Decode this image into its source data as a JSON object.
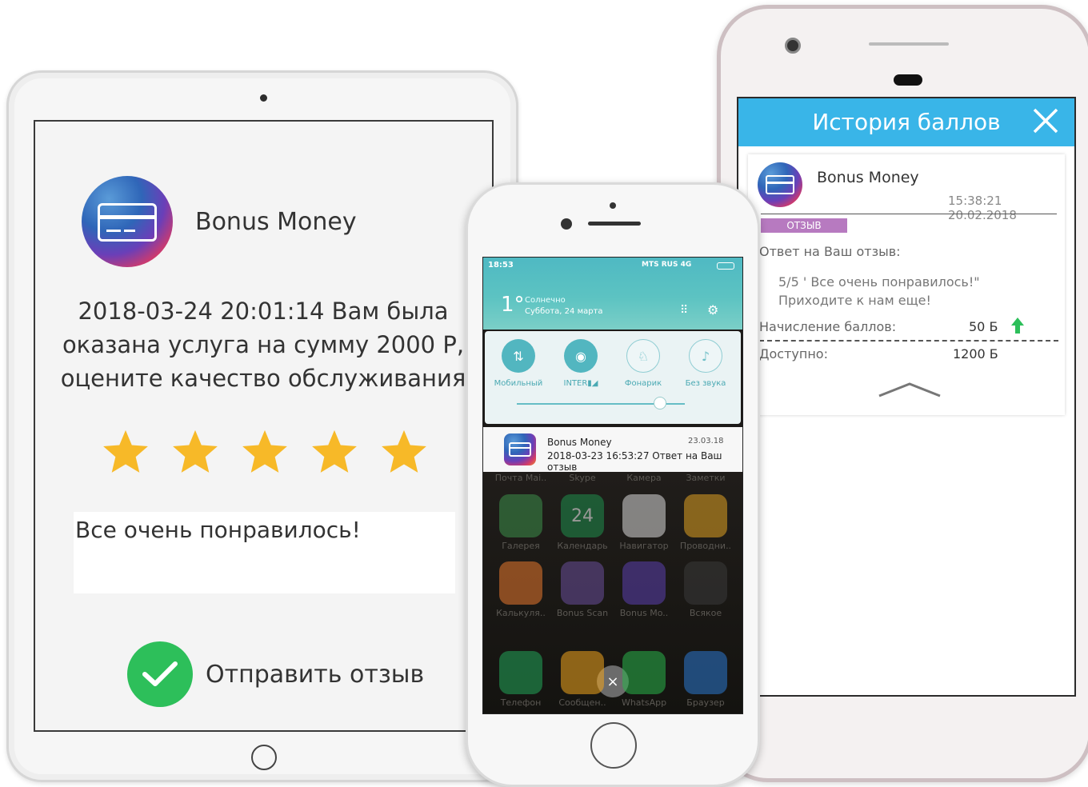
{
  "tablet": {
    "brand": "Bonus Money",
    "message": "2018-03-24 20:01:14 Вам была оказана услуга на сумму 2000 Р, оцените качество обслуживания",
    "rating": 5,
    "review_text": "Все очень понравилось!",
    "send_label": "Отправить отзыв",
    "colors": {
      "star": "#f7b928",
      "send": "#2dbf5a"
    }
  },
  "history": {
    "title": "История баллов",
    "brand": "Bonus Money",
    "timestamp": "15:38:21 20.02.2018",
    "tag": "ОТЗЫВ",
    "answer_label": "Ответ на Ваш отзыв:",
    "quote_line1": "5/5 ' Все очень понравилось!\"",
    "quote_line2": "Приходите к нам еще!",
    "accrual_label": "Начисление баллов:",
    "accrual_value": "50 Б",
    "available_label": "Доступно:",
    "available_value": "1200 Б",
    "colors": {
      "header": "#39b5e8",
      "tag": "#b77ac0",
      "arrow": "#2dbf5a"
    }
  },
  "iphone": {
    "status_time": "18:53",
    "carrier": "MTS RUS 4G",
    "temperature": "1°",
    "weather": "Солнечно",
    "date": "Суббота, 24 марта",
    "quick_settings": [
      {
        "label": "Мобильный",
        "icon": "data-arrows-icon",
        "glyph": "⇅",
        "state": "on"
      },
      {
        "label": "INTER▮◢",
        "icon": "wifi-icon",
        "glyph": "◉",
        "state": "on"
      },
      {
        "label": "Фонарик",
        "icon": "flashlight-icon",
        "glyph": "♘",
        "state": "off"
      },
      {
        "label": "Без звука",
        "icon": "bell-off-icon",
        "glyph": "♪",
        "state": "off"
      }
    ],
    "brightness": 0.85,
    "notification": {
      "title": "Bonus Money",
      "date": "23.03.18",
      "body": "2018-03-23 16:53:27 Ответ на Ваш отзыв"
    },
    "top_labels": [
      "Почта Mai..",
      "Skype",
      "Камера",
      "Заметки"
    ],
    "apps_row1": [
      {
        "label": "Галерея",
        "color": "#3d8f4a"
      },
      {
        "label": "Календарь",
        "color": "#1f8f4d",
        "text": "24"
      },
      {
        "label": "Навигатор",
        "color": "#d8d8d8"
      },
      {
        "label": "Проводни..",
        "color": "#e0a323"
      }
    ],
    "apps_row2": [
      {
        "label": "Калькуля..",
        "color": "#e8792d"
      },
      {
        "label": "Bonus Scan",
        "color": "#6a4f9a"
      },
      {
        "label": "Bonus Mo..",
        "color": "#5b3fae"
      },
      {
        "label": "Всякое",
        "color": "#3a3a3a"
      }
    ],
    "apps_row3": [
      {
        "label": "Телефон",
        "color": "#23a55a"
      },
      {
        "label": "Сообщен..",
        "color": "#f2a51d"
      },
      {
        "label": "WhatsApp",
        "color": "#2ab54a"
      },
      {
        "label": "Браузер",
        "color": "#2b79d0"
      }
    ],
    "close_glyph": "×"
  }
}
